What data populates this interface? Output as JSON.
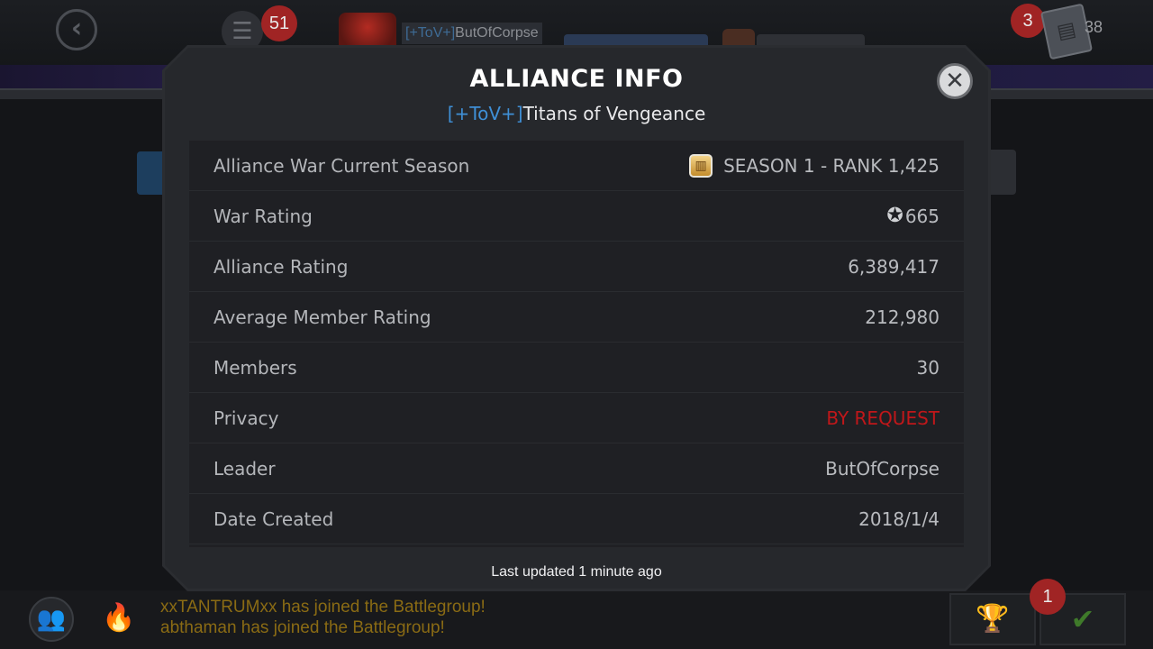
{
  "topbar": {
    "notification_count": "51",
    "player_tag": "[+ToV+]",
    "player_name": "ButOfCorpse",
    "right_count": "3",
    "cards_count": "38"
  },
  "modal": {
    "title": "ALLIANCE INFO",
    "alliance_tag": "[+ToV+]",
    "alliance_name": "Titans of Vengeance",
    "rows": [
      {
        "label": "Alliance War Current Season",
        "value": "SEASON 1 - RANK 1,425",
        "icon": "season-badge-icon"
      },
      {
        "label": "War Rating",
        "value": "665",
        "icon": "war-rating-icon"
      },
      {
        "label": "Alliance Rating",
        "value": "6,389,417"
      },
      {
        "label": "Average Member Rating",
        "value": "212,980"
      },
      {
        "label": "Members",
        "value": "30"
      },
      {
        "label": "Privacy",
        "value": "BY REQUEST",
        "color": "#c0171a"
      },
      {
        "label": "Leader",
        "value": "ButOfCorpse"
      },
      {
        "label": "Date Created",
        "value": "2018/1/4"
      }
    ],
    "footer": "Last updated 1 minute ago"
  },
  "bottombar": {
    "feed": [
      "xxTANTRUMxx has joined the Battlegroup!",
      "abthaman has joined the Battlegroup!"
    ],
    "quest_count": "1"
  },
  "colors": {
    "accent_blue": "#3f8fd6",
    "privacy_red": "#c0171a",
    "feed_gold": "#8a6b14"
  }
}
